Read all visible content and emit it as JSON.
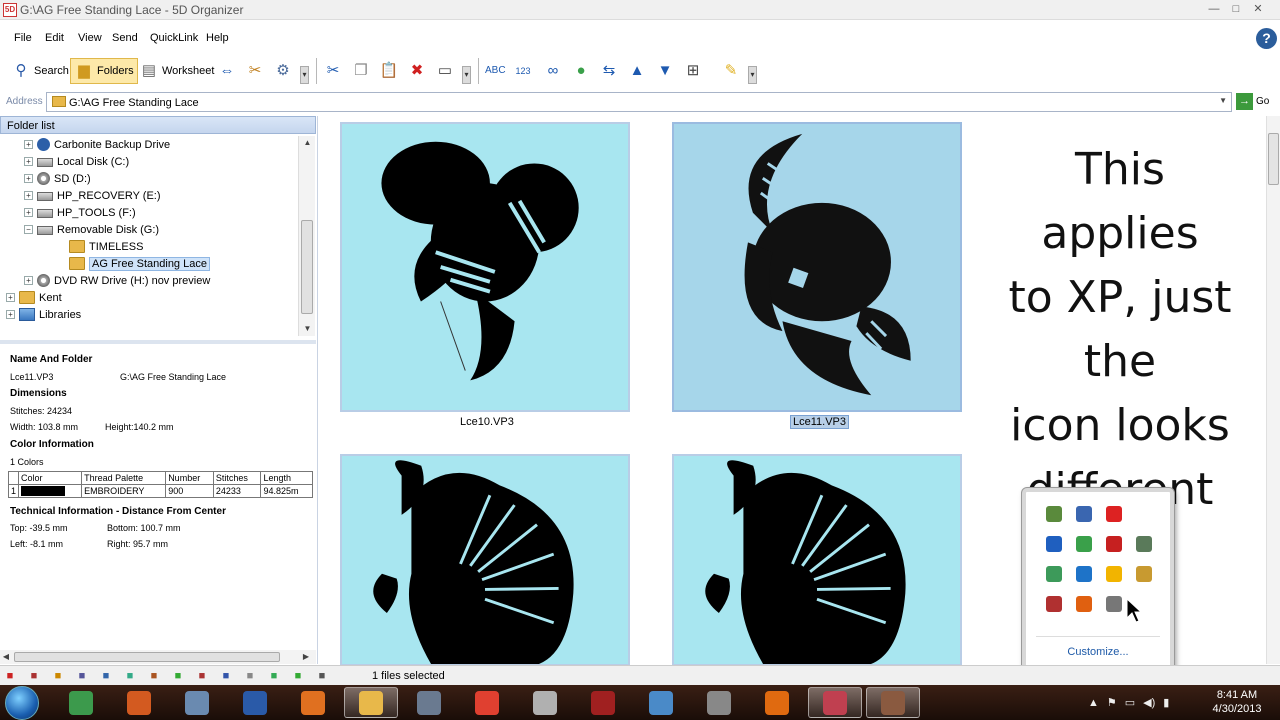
{
  "window": {
    "app_icon": "5D",
    "title": "G:\\AG Free Standing Lace - 5D Organizer",
    "minimize": "—",
    "maximize": "□",
    "close": "✕"
  },
  "menu": [
    "File",
    "Edit",
    "View",
    "Send",
    "QuickLink",
    "Help"
  ],
  "help_button": "?",
  "toolbar": {
    "search_label": "Search",
    "folders_label": "Folders",
    "worksheet_label": "Worksheet",
    "grip": "▾"
  },
  "address": {
    "label": "Address",
    "path": "G:\\AG Free Standing Lace",
    "go_label": "Go",
    "go_arrow": "→",
    "dropdown": "▼"
  },
  "folder_list": {
    "header": "Folder list",
    "items": [
      {
        "label": "Carbonite Backup Drive",
        "expander": "+",
        "icon": "carbonite-icon"
      },
      {
        "label": "Local Disk (C:)",
        "expander": "+",
        "icon": "local-disk-icon"
      },
      {
        "label": "SD (D:)",
        "expander": "+",
        "icon": "sd-disc-icon"
      },
      {
        "label": "HP_RECOVERY (E:)",
        "expander": "+",
        "icon": "drive-icon"
      },
      {
        "label": "HP_TOOLS (F:)",
        "expander": "+",
        "icon": "drive-icon"
      },
      {
        "label": "Removable Disk (G:)",
        "expander": "−",
        "icon": "removable-disk-icon"
      },
      {
        "label": "TIMELESS",
        "expander": "",
        "icon": "folder-icon"
      },
      {
        "label": "AG Free Standing Lace",
        "expander": "",
        "icon": "folder-icon",
        "selected": true
      },
      {
        "label": "DVD RW Drive (H:) nov preview",
        "expander": "+",
        "icon": "dvd-icon"
      },
      {
        "label": "Kent",
        "expander": "+",
        "icon": "folder-icon"
      },
      {
        "label": "Libraries",
        "expander": "+",
        "icon": "libraries-icon"
      }
    ],
    "scroll_up": "▲",
    "scroll_down": "▼"
  },
  "info": {
    "name_folder_header": "Name And Folder",
    "file_name": "Lce11.VP3",
    "folder": "G:\\AG Free Standing Lace",
    "dimensions_header": "Dimensions",
    "stitches": "Stitches: 24234",
    "width": "Width: 103.8 mm",
    "height": "Height:140.2 mm",
    "color_info_header": "Color Information",
    "colors_count": "1 Colors",
    "color_table": {
      "headers": [
        "Color",
        "Thread Palette",
        "Number",
        "Stitches",
        "Length"
      ],
      "rows": [
        {
          "index": "1",
          "swatch": "#000000",
          "palette": "EMBROIDERY",
          "number": "900",
          "stitches": "24233",
          "length": "94.825m"
        }
      ]
    },
    "technical_header": "Technical Information - Distance From Center",
    "top": "Top: -39.5 mm",
    "bottom": "Bottom: 100.7 mm",
    "left": "Left: -8.1 mm",
    "right": "Right: 95.7 mm",
    "hscroll_left": "◀",
    "hscroll_right": "▶"
  },
  "files": [
    {
      "name": "Lce10.VP3",
      "selected": false
    },
    {
      "name": "Lce11.VP3",
      "selected": true
    },
    {
      "name": "",
      "selected": false
    },
    {
      "name": "",
      "selected": false
    }
  ],
  "overlay_text": [
    "This applies",
    "to XP, just",
    "the",
    "icon looks",
    "different"
  ],
  "tray_popup": {
    "customize_label": "Customize...",
    "icons": [
      {
        "name": "network-tray-icon",
        "color": "#5a8a3c"
      },
      {
        "name": "shield-tray-icon",
        "color": "#3a66b0"
      },
      {
        "name": "beats-tray-icon",
        "color": "#d22"
      },
      {
        "name": "bluetooth-tray-icon",
        "color": "#1f5fbf"
      },
      {
        "name": "recycle-tray-icon",
        "color": "#3aa04a"
      },
      {
        "name": "acrobat-tray-icon",
        "color": "#c62020"
      },
      {
        "name": "tool-tray-icon",
        "color": "#5a7a5a"
      },
      {
        "name": "sync-tray-icon",
        "color": "#3d9a5a"
      },
      {
        "name": "hp-tray-icon",
        "color": "#1e73c8"
      },
      {
        "name": "drive-tray-icon",
        "color": "#f2b400"
      },
      {
        "name": "face-tray-icon",
        "color": "#c89a30"
      },
      {
        "name": "wrench-tray-icon",
        "color": "#b03030"
      },
      {
        "name": "windows-tray-icon",
        "color": "#e06010"
      },
      {
        "name": "window-tray-icon",
        "color": "#777777"
      }
    ]
  },
  "statusbar": {
    "status_text": "1 files selected",
    "icons": [
      "5d-status-icon",
      "design-status-icon",
      "lace-status-icon",
      "trash-status-icon",
      "scissors-status-icon",
      "globe-status-icon",
      "paint-status-icon",
      "recycle-status-icon",
      "stitch-status-icon",
      "grid-status-icon",
      "bottle-status-icon",
      "tools-status-icon",
      "tree-status-icon",
      "hoop-status-icon"
    ]
  },
  "taskbar": {
    "apps": [
      {
        "name": "taskbar-app-paint",
        "color": "#3c9a4c",
        "active": false
      },
      {
        "name": "taskbar-app-powerpoint",
        "color": "#d35a20",
        "active": false
      },
      {
        "name": "taskbar-app-embird",
        "color": "#6a8ab0",
        "active": false
      },
      {
        "name": "taskbar-app-blue",
        "color": "#2a5aa8",
        "active": false
      },
      {
        "name": "taskbar-app-media",
        "color": "#e07020",
        "active": false
      },
      {
        "name": "taskbar-app-explorer",
        "color": "#e8b84a",
        "active": true
      },
      {
        "name": "taskbar-app-calculator",
        "color": "#6a7a90",
        "active": false
      },
      {
        "name": "taskbar-app-chrome",
        "color": "#e04030",
        "active": false
      },
      {
        "name": "taskbar-app-box",
        "color": "#b0b0b0",
        "active": false
      },
      {
        "name": "taskbar-app-vrs",
        "color": "#a02020",
        "active": false
      },
      {
        "name": "taskbar-app-ruler",
        "color": "#4a8ac8",
        "active": false
      },
      {
        "name": "taskbar-app-eye",
        "color": "#888888",
        "active": false
      },
      {
        "name": "taskbar-app-kt",
        "color": "#e06a10",
        "active": false
      },
      {
        "name": "taskbar-app-5d-1",
        "color": "#c04050",
        "active": true
      },
      {
        "name": "taskbar-app-5d-2",
        "color": "#8a5a40",
        "active": true
      }
    ],
    "tray_arrow": "▲",
    "clock_time": "8:41 AM",
    "clock_date": "4/30/2013"
  }
}
